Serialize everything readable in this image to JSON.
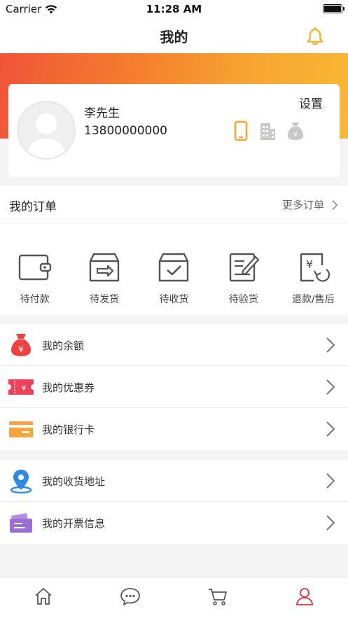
{
  "status_bar": {
    "carrier": "Carrier",
    "time": "11:28 AM"
  },
  "nav": {
    "title": "我的"
  },
  "profile": {
    "name": "李先生",
    "phone": "13800000000",
    "settings_label": "设置"
  },
  "orders": {
    "title": "我的订单",
    "more_label": "更多订单",
    "items": [
      {
        "label": "待付款",
        "icon": "wallet-icon"
      },
      {
        "label": "待发货",
        "icon": "box-arrow-icon"
      },
      {
        "label": "待收货",
        "icon": "box-check-icon"
      },
      {
        "label": "待验货",
        "icon": "document-edit-icon"
      },
      {
        "label": "退款/售后",
        "icon": "refund-icon"
      }
    ]
  },
  "finance": {
    "items": [
      {
        "label": "我的余额",
        "icon": "money-bag-icon"
      },
      {
        "label": "我的优惠券",
        "icon": "coupon-icon"
      },
      {
        "label": "我的银行卡",
        "icon": "bank-card-icon"
      }
    ]
  },
  "info": {
    "items": [
      {
        "label": "我的收货地址",
        "icon": "location-pin-icon"
      },
      {
        "label": "我的开票信息",
        "icon": "invoice-icon"
      }
    ]
  },
  "tabs": [
    {
      "name": "home",
      "icon": "home-icon"
    },
    {
      "name": "messages",
      "icon": "chat-icon"
    },
    {
      "name": "cart",
      "icon": "cart-icon"
    },
    {
      "name": "profile",
      "icon": "user-icon",
      "active": true
    }
  ],
  "colors": {
    "accent_orange": "#f5a623",
    "active_red": "#e02e3c",
    "gray_icon": "#bdbdbd"
  }
}
